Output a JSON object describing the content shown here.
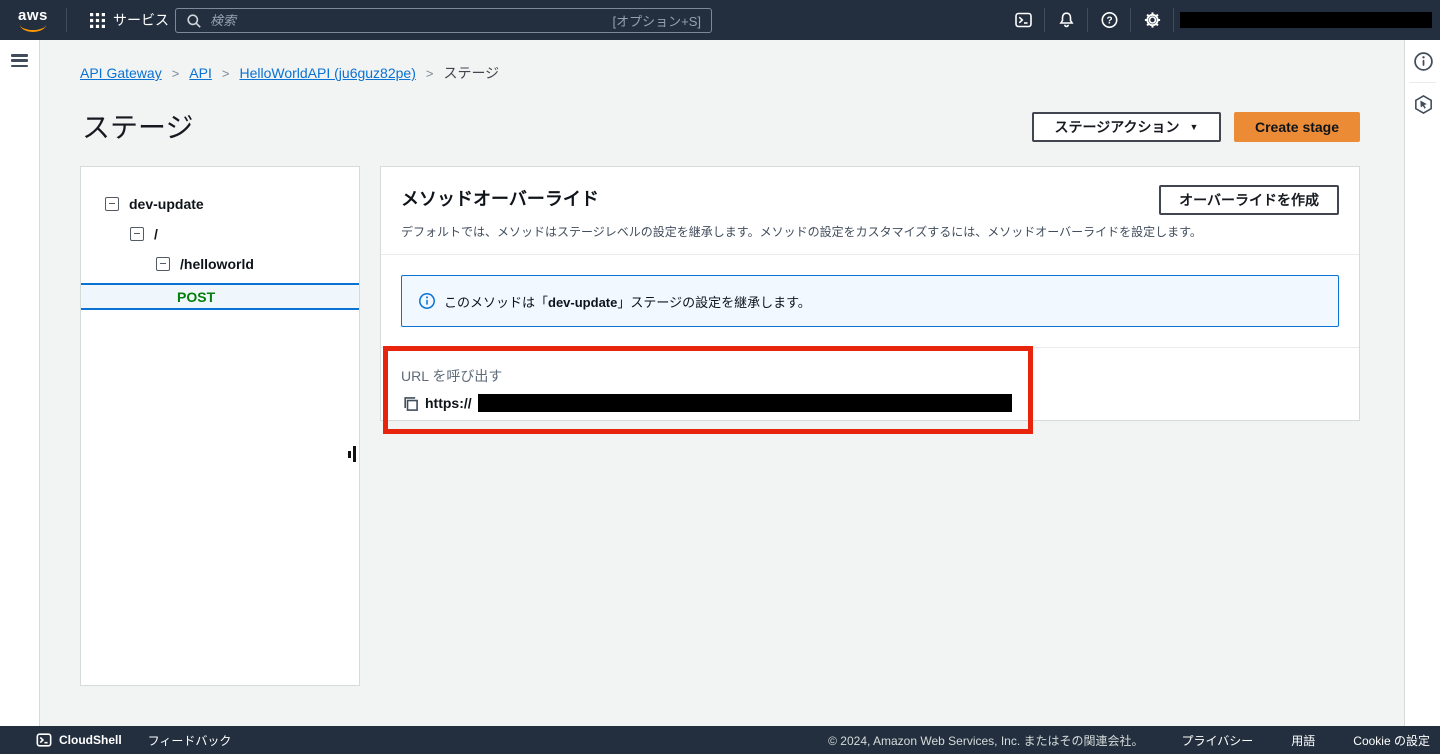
{
  "topnav": {
    "logo_text": "aws",
    "services_label": "サービス",
    "search": {
      "placeholder": "検索",
      "shortcut_hint": "[オプション+S]"
    }
  },
  "breadcrumb": {
    "items": [
      "API Gateway",
      "API",
      "HelloWorldAPI (ju6guz82pe)"
    ],
    "current": "ステージ"
  },
  "page": {
    "title": "ステージ",
    "stage_actions_button": "ステージアクション",
    "create_stage_button": "Create stage"
  },
  "resource_tree": {
    "stage": "dev-update",
    "root_path": "/",
    "resource_path": "/helloworld",
    "method": "POST"
  },
  "method_override_panel": {
    "title": "メソッドオーバーライド",
    "description": "デフォルトでは、メソッドはステージレベルの設定を継承します。メソッドの設定をカスタマイズするには、メソッドオーバーライドを設定します。",
    "create_override_button": "オーバーライドを作成",
    "alert": {
      "pre": "このメソッドは「",
      "stage_name": "dev-update",
      "post": "」ステージの設定を継承します。"
    },
    "invoke_url": {
      "label": "URL を呼び出す",
      "url_prefix": "https://"
    }
  },
  "footer": {
    "cloudshell_label": "CloudShell",
    "feedback_label": "フィードバック",
    "copyright": "© 2024, Amazon Web Services, Inc. またはその関連会社。",
    "links": [
      "プライバシー",
      "用語",
      "Cookie の設定"
    ]
  },
  "colors": {
    "header_bg": "#232f3e",
    "primary_button_bg": "#eb8b36",
    "link_blue": "#0972d3",
    "method_green": "#037f0c",
    "alert_border": "#0972d3",
    "alert_bg": "#f1f8ff",
    "annotation_red": "#e8250c",
    "page_bg": "#f2f3f3"
  }
}
